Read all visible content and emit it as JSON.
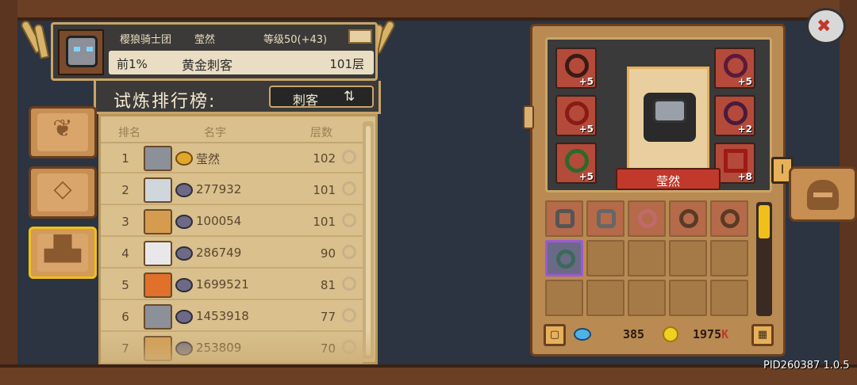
{
  "header": {
    "guild": "樱狼骑士团",
    "player_name": "莹然",
    "level": "等级50(+43)",
    "rank_percent": "前1%",
    "title": "黄金刺客",
    "floor": "101层"
  },
  "trial": {
    "label": "试炼排行榜:",
    "class_select": "刺客",
    "switch_icon": "⇅"
  },
  "ranking": {
    "columns": [
      "排名",
      "名字",
      "层数"
    ],
    "rows": [
      {
        "rank": "1",
        "name": "莹然",
        "floor": "102",
        "avatar_color": "#8b9099",
        "badge": "gold"
      },
      {
        "rank": "2",
        "name": "277932",
        "floor": "101",
        "avatar_color": "#cfd6dc",
        "badge": "gray"
      },
      {
        "rank": "3",
        "name": "100054",
        "floor": "101",
        "avatar_color": "#d59b4e",
        "badge": "gray"
      },
      {
        "rank": "4",
        "name": "286749",
        "floor": "90",
        "avatar_color": "#e8e8ea",
        "badge": "gray"
      },
      {
        "rank": "5",
        "name": "1699521",
        "floor": "81",
        "avatar_color": "#e0702a",
        "badge": "gray"
      },
      {
        "rank": "6",
        "name": "1453918",
        "floor": "77",
        "avatar_color": "#8b9099",
        "badge": "gray"
      },
      {
        "rank": "7",
        "name": "253809",
        "floor": "70",
        "avatar_color": "#d59b4e",
        "badge": "gray"
      }
    ]
  },
  "equipment": {
    "hero_name": "莹然",
    "tab_label": "I",
    "slots_left": [
      {
        "bonus": "+5"
      },
      {
        "bonus": "+5"
      },
      {
        "bonus": "+5"
      }
    ],
    "slots_right": [
      {
        "bonus": "+5"
      },
      {
        "bonus": "+2"
      },
      {
        "bonus": "+8"
      }
    ]
  },
  "currency": {
    "gems": "385",
    "gold": "1975",
    "gold_suffix": "K"
  },
  "icons": {
    "close": "close-icon",
    "helmet": "helmet-icon"
  },
  "footer": {
    "pid": "PID260387 1.0.5"
  }
}
